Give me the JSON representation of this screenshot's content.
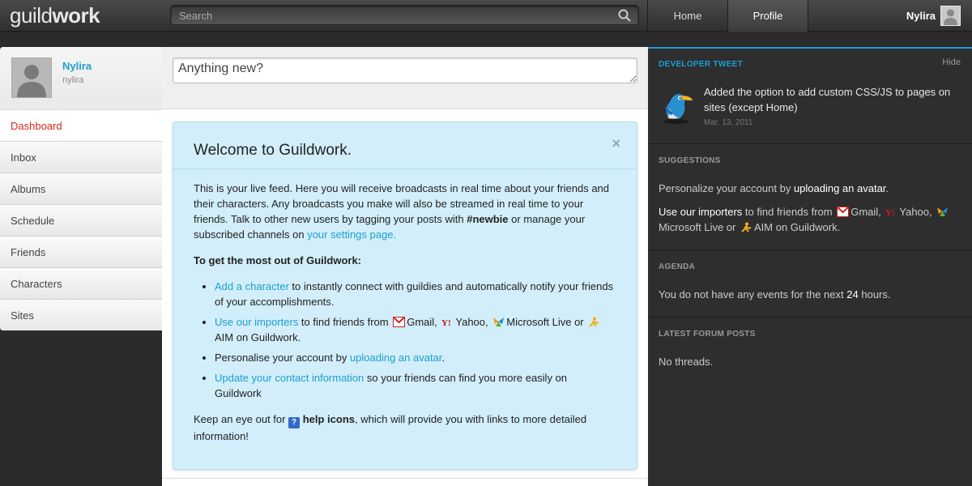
{
  "header": {
    "logo_light": "guild",
    "logo_bold": "work",
    "search_placeholder": "Search",
    "nav_home": "Home",
    "nav_profile": "Profile",
    "user_name": "Nylira"
  },
  "sidebar": {
    "profile_name": "Nylira",
    "profile_handle": "nylira",
    "items": [
      {
        "label": "Dashboard"
      },
      {
        "label": "Inbox"
      },
      {
        "label": "Albums"
      },
      {
        "label": "Schedule"
      },
      {
        "label": "Friends"
      },
      {
        "label": "Characters"
      },
      {
        "label": "Sites"
      }
    ]
  },
  "main": {
    "status_placeholder": "Anything new?",
    "welcome": {
      "title": "Welcome to Guildwork.",
      "close": "×",
      "intro": "This is your live feed. Here you will receive broadcasts in real time about your friends and their characters. Any broadcasts you make will also be streamed in real time to your friends. Talk to other new users by tagging your posts with ",
      "intro_tag": "#newbie",
      "intro_mid": " or manage your subscribed channels on ",
      "intro_link": "your settings page.",
      "subhead": "To get the most out of Guildwork:",
      "b1_link": "Add a character",
      "b1_text": " to instantly connect with guildies and automatically notify your friends of your accomplishments.",
      "b2_link": "Use our importers",
      "b2_text1": " to find friends from ",
      "b2_gmail": "Gmail,",
      "b2_yahoo": "Yahoo,",
      "b2_ms": "Microsoft Live or",
      "b2_aim": "AIM on Guildwork.",
      "b3_text": "Personalise your account by ",
      "b3_link": "uploading an avatar",
      "b3_end": ".",
      "b4_link": "Update your contact information",
      "b4_text": " so your friends can find you more easily on Guildwork",
      "outro1": "Keep an eye out for ",
      "outro_icon": "?",
      "outro_bold": "help icons",
      "outro2": ", which will provide you with links to more detailed information!"
    }
  },
  "right": {
    "tweet_title": "Developer Tweet",
    "hide": "Hide",
    "tweet_text": "Added the option to add custom CSS/JS to pages on sites (except Home)",
    "tweet_date": "Mar. 13, 2011",
    "suggestions_title": "Suggestions",
    "sugg1_text": "Personalize your account by ",
    "sugg1_bold": "uploading an avatar",
    "sugg1_end": ".",
    "sugg2_bold": "Use our importers",
    "sugg2_text": " to find friends from ",
    "sugg2_gmail": "Gmail,",
    "sugg2_yahoo": "Yahoo,",
    "sugg2_ms": "Microsoft Live or",
    "sugg2_aim": "AIM on Guildwork.",
    "agenda_title": "Agenda",
    "agenda_text1": "You do not have any events for the next ",
    "agenda_bold": "24",
    "agenda_text2": " hours.",
    "forum_title": "Latest Forum Posts",
    "forum_text": "No threads."
  },
  "colors": {
    "accent": "#1a9fd4",
    "active_menu": "#d8261a",
    "welcome_bg": "#d2eefa"
  }
}
